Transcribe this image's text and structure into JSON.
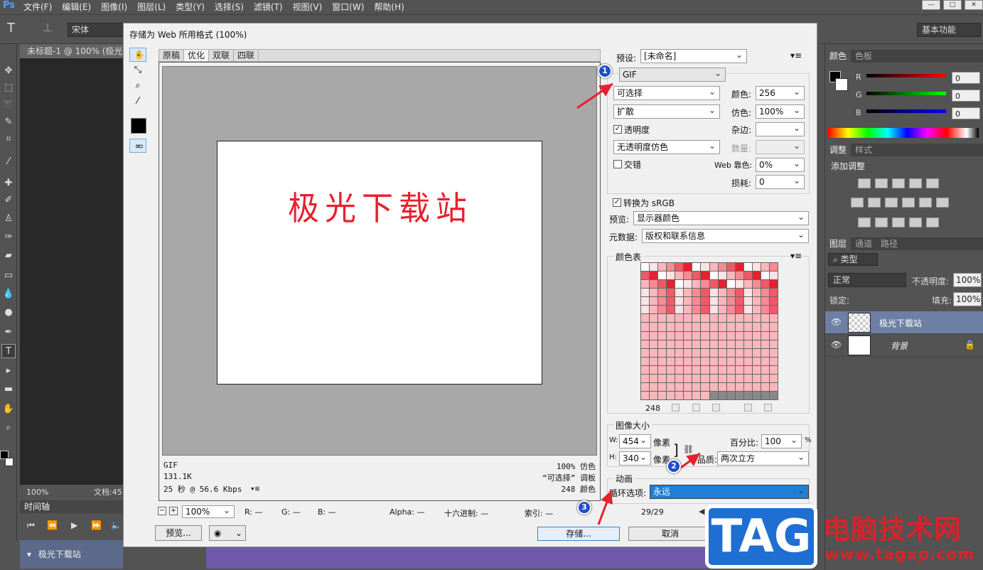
{
  "app": {
    "logo": "Ps",
    "menu": [
      "文件(F)",
      "编辑(E)",
      "图像(I)",
      "图层(L)",
      "类型(Y)",
      "选择(S)",
      "滤镜(T)",
      "视图(V)",
      "窗口(W)",
      "帮助(H)"
    ],
    "font_family_value": "宋体",
    "workspace": "基本功能",
    "doc_tab": "未标题-1 @ 100% (极光",
    "zoom_status": "100%",
    "doc_status": "文档:45",
    "timeline_tab": "时间轴",
    "timeline_layer": "极光下载站"
  },
  "color_panel": {
    "tabs": [
      "颜色",
      "色板"
    ],
    "channels": [
      {
        "label": "R",
        "value": "0"
      },
      {
        "label": "G",
        "value": "0"
      },
      {
        "label": "B",
        "value": "0"
      }
    ]
  },
  "adjust_panel": {
    "tabs": [
      "调整",
      "样式"
    ],
    "title": "添加调整"
  },
  "layers_panel": {
    "tabs": [
      "图层",
      "通道",
      "路径"
    ],
    "filter": "类型",
    "blend_mode": "正常",
    "opacity_label": "不透明度:",
    "opacity": "100%",
    "lock_label": "锁定:",
    "fill_label": "填充:",
    "fill": "100%",
    "layers": [
      {
        "name": "极光下载站",
        "selected": true
      },
      {
        "name": "背景",
        "selected": false
      }
    ]
  },
  "dialog": {
    "title": "存储为 Web 所用格式 (100%)",
    "view_tabs": [
      "原稿",
      "优化",
      "双联",
      "四联"
    ],
    "active_view_tab": "优化",
    "preview_text": "极光下载站",
    "info_left": [
      "GIF",
      "131.1K",
      "25 秒 @ 56.6 Kbps"
    ],
    "info_right": [
      "100% 仿色",
      "“可选择” 调板",
      "248 颜色"
    ],
    "zoom": "100%",
    "readout": {
      "r": "R: —",
      "g": "G: —",
      "b": "B: —",
      "alpha": "Alpha: —",
      "hex": "十六进制: —",
      "index": "索引: —"
    },
    "frame_counter": "29/29",
    "buttons": {
      "preview": "预览...",
      "save": "存储...",
      "cancel": "取消"
    },
    "settings": {
      "preset_label": "预设:",
      "preset": "[未命名]",
      "format": "GIF",
      "reduction": "可选择",
      "colors_label": "颜色:",
      "colors": "256",
      "dither_algo": "扩散",
      "dither_label": "仿色:",
      "dither": "100%",
      "transparency_label": "透明度",
      "transparency_checked": true,
      "matte_label": "杂边:",
      "matte": "",
      "transparency_dither": "无透明度仿色",
      "amount_label": "数量:",
      "amount": "",
      "interlaced_label": "交错",
      "interlaced_checked": false,
      "web_snap_label": "Web 靠色:",
      "web_snap": "0%",
      "lossy_label": "损耗:",
      "lossy": "0",
      "convert_srgb_label": "转换为 sRGB",
      "convert_srgb_checked": true,
      "preview_label": "预览:",
      "preview_mode": "显示器颜色",
      "metadata_label": "元数据:",
      "metadata": "版权和联系信息",
      "color_table_title": "颜色表",
      "color_count": "248",
      "image_size_title": "图像大小",
      "w_label": "W:",
      "width": "454",
      "h_label": "H:",
      "height": "340",
      "unit": "像素",
      "percent_label": "百分比:",
      "percent": "100",
      "percent_unit": "%",
      "quality_label": "品质:",
      "quality": "两次立方",
      "animation_title": "动画",
      "loop_label": "循环选项:",
      "loop": "永远"
    }
  },
  "annotations": [
    "1",
    "2",
    "3"
  ],
  "watermark": {
    "logo": "TAG",
    "name": "电脑技术网",
    "url": "www.tagxp.com"
  },
  "colors": {
    "accent_red": "#e8202e",
    "selection_blue": "#1e7fd6",
    "badge_blue": "#1e4fc9"
  }
}
